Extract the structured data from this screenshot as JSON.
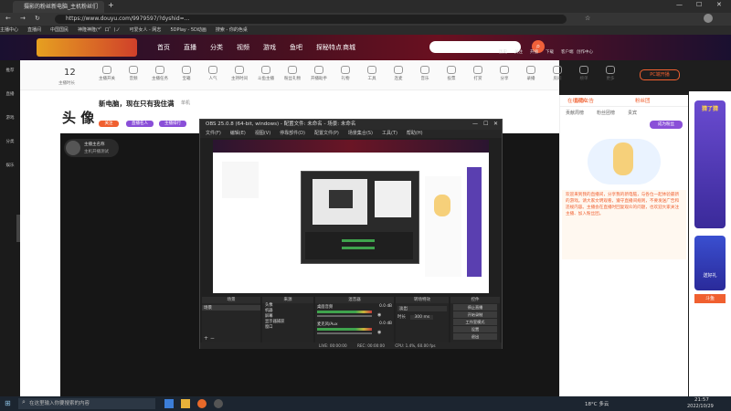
{
  "browser": {
    "tab_title": "摄影的粉丝新电脑_主机粉丝们",
    "url": "https://www.douyu.com/9979597/?dyshid=...",
    "bookmarks": [
      "主播中心",
      "直播间",
      "中国国民",
      "神隆神隆(*゜ロ゜)ノ",
      "可爱女人 - 网志",
      "5DPlay - 5D动画",
      "搜索 - 你的色桌"
    ]
  },
  "site": {
    "nav": [
      "首页",
      "直播",
      "分类",
      "视频",
      "游戏",
      "鱼吧",
      "探秘特点",
      "商城"
    ],
    "nav_right": [
      "历史",
      "关注",
      "开播",
      "下载",
      "客户端",
      "创作中心"
    ],
    "search_placeholder": ""
  },
  "left_sidebar": [
    "推荐",
    "直播",
    "游戏",
    "分类",
    "娱乐"
  ],
  "toolbar": {
    "count": "12",
    "count_label": "主播时长",
    "items": [
      "主播开关",
      "音频",
      "主播任务",
      "宝箱",
      "人气",
      "主持时间",
      "斗鱼主播",
      "粉丝礼物",
      "开播助手",
      "礼物",
      "工具",
      "连麦",
      "音乐",
      "投票",
      "打赏",
      "分享",
      "录播",
      "房间",
      "榜单",
      "更多"
    ],
    "pc_live": "PC端开播"
  },
  "room": {
    "title": "新电脑，现在只有我住满",
    "category": "单机",
    "anchor": "头 像",
    "follow": "关注",
    "tags": [
      "直播名人",
      "主播排行"
    ],
    "streamer_name": "主播主名称",
    "streamer_sub": "主机开播测试"
  },
  "obs": {
    "title": "OBS 25.0.8 (64-bit, windows) - 配置文件: 未命名 - 场景: 未命名",
    "menu": [
      "文件(F)",
      "编辑(E)",
      "视图(V)",
      "停靠部件(D)",
      "配置文件(P)",
      "场景集合(S)",
      "工具(T)",
      "帮助(H)"
    ],
    "docks": {
      "scenes": "场景",
      "sources": "来源",
      "mixer": "混音器",
      "transitions": "转场特效",
      "controls": "控件"
    },
    "scene_item": "场景",
    "sources": [
      "头像",
      "机器",
      "屏幕",
      "显示器捕获",
      "窗口"
    ],
    "mixer_tracks": [
      "桌面音频",
      "麦克风/Aux"
    ],
    "mixer_db": [
      "0.0 dB",
      "0.0 dB"
    ],
    "transition": "淡出",
    "duration_label": "时长",
    "duration": "300 ms",
    "controls": [
      "停止直播",
      "开始录制",
      "工作室模式",
      "设置",
      "退出"
    ],
    "status": [
      "LIVE: 00:00:00",
      "REC: 00:00:00",
      "CPU: 1.4%, 60.00 fps"
    ]
  },
  "right_panel": {
    "tabs": [
      "在线观众",
      "粉丝团"
    ],
    "header": "直播公告",
    "sub_tabs": [
      "贡献周榜",
      "粉丝团榜",
      "贵宾"
    ],
    "notice": "欢迎来到我的直播间，分享我的新电脑，与各位一起体验最新的游戏。请大家文明观看，遵守直播间规则，不要发送广告和违规内容。主播会在直播时回复观众的问题，也欢迎大家关注主播、加入粉丝团。",
    "join_btn": "成为粉丝"
  },
  "ads": [
    "猜了猜",
    "斗鱼",
    "送好礼"
  ],
  "taskbar": {
    "search": "在这里输入你要搜索的内容",
    "weather": "18°C 多云",
    "time": "21:57",
    "date": "2022/10/29"
  }
}
